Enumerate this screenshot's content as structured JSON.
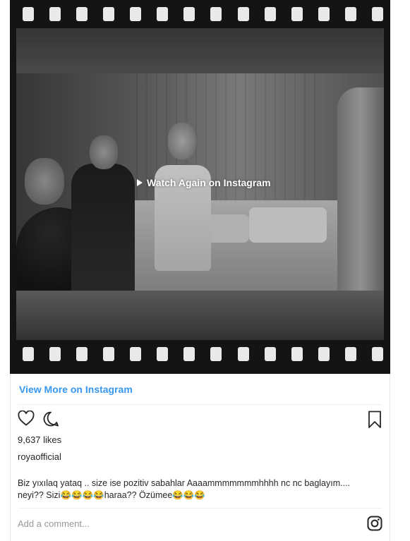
{
  "video": {
    "watch_again_label": "Watch Again on Instagram"
  },
  "links": {
    "view_more": "View More on Instagram"
  },
  "post": {
    "likes": "9,637 likes",
    "username": "royaofficial",
    "caption_line1": "Biz yıxılaq yataq .. size ise pozitiv sabahlar Aaaammmmmmmhhhh nc nc baglayım....",
    "caption_line2": "neyi?? Sizi😂😂😂😂haraa?? Özümee😂😂😂"
  },
  "comment": {
    "placeholder": "Add a comment..."
  },
  "icons": {
    "like": "heart-icon",
    "comment": "comment-bubble-icon",
    "save": "bookmark-icon",
    "logo": "instagram-logo-icon",
    "play": "play-icon"
  },
  "colors": {
    "link": "#3897f0",
    "film": "#141414",
    "text": "#262626",
    "muted": "#999999"
  }
}
